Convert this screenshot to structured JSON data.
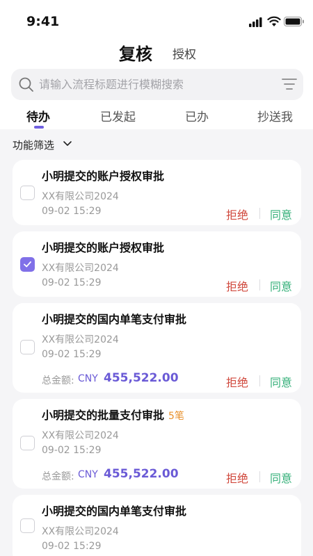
{
  "status_bar": {
    "time": "9:41"
  },
  "header": {
    "title": "复核",
    "subtitle": "授权"
  },
  "search": {
    "placeholder": "请输入流程标题进行模糊搜索"
  },
  "tabs": [
    {
      "label": "待办",
      "active": true
    },
    {
      "label": "已发起",
      "active": false
    },
    {
      "label": "已办",
      "active": false
    },
    {
      "label": "抄送我",
      "active": false
    }
  ],
  "filter": {
    "label": "功能筛选"
  },
  "actions": {
    "reject": "拒绝",
    "approve": "同意"
  },
  "amount_label": "总金额:",
  "currency": "CNY",
  "cards": [
    {
      "title": "小明提交的账户授权审批",
      "company": "XX有限公司2024",
      "date": "09-02 15:29",
      "checked": false
    },
    {
      "title": "小明提交的账户授权审批",
      "company": "XX有限公司2024",
      "date": "09-02 15:29",
      "checked": true
    },
    {
      "title": "小明提交的国内单笔支付审批",
      "company": "XX有限公司2024",
      "date": "09-02 15:29",
      "checked": false,
      "amount": "455,522.00"
    },
    {
      "title": "小明提交的批量支付审批",
      "tag": "5笔",
      "company": "XX有限公司2024",
      "date": "09-02 15:29",
      "checked": false,
      "amount": "455,522.00"
    },
    {
      "title": "小明提交的国内单笔支付审批",
      "company": "XX有限公司2024",
      "date": "09-02 15:29",
      "checked": false
    }
  ],
  "colors": {
    "accent": "#7060e0",
    "reject": "#d0483c",
    "approve": "#36b07a",
    "tag": "#e8902a"
  }
}
